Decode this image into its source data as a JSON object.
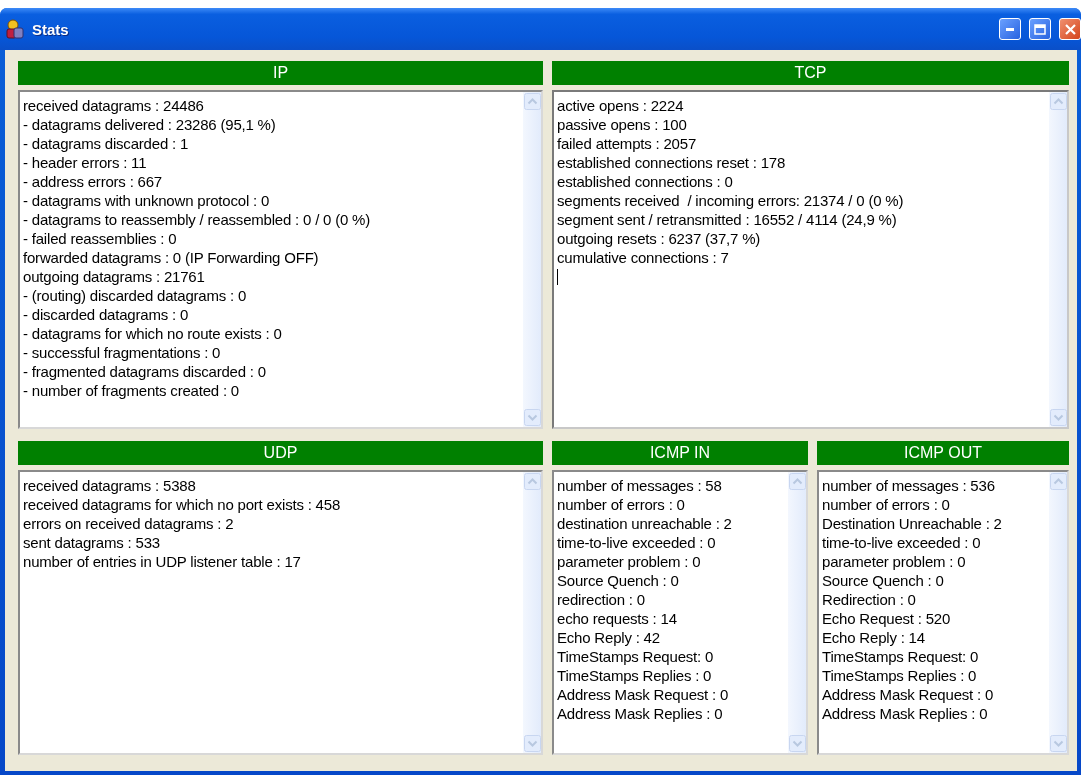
{
  "window": {
    "title": "Stats"
  },
  "rows": [
    {
      "panels": [
        {
          "title": "IP",
          "focused": false,
          "lines": [
            "received datagrams : 24486",
            "- datagrams delivered : 23286 (95,1 %)",
            "- datagrams discarded : 1",
            "- header errors : 11",
            "- address errors : 667",
            "- datagrams with unknown protocol : 0",
            "- datagrams to reassembly / reassembled : 0 / 0 (0 %)",
            "- failed reassemblies : 0",
            "forwarded datagrams : 0 (IP Forwarding OFF)",
            "outgoing datagrams : 21761",
            "- (routing) discarded datagrams : 0",
            "- discarded datagrams : 0",
            "- datagrams for which no route exists : 0",
            "- successful fragmentations : 0",
            "- fragmented datagrams discarded : 0",
            "- number of fragments created : 0"
          ]
        },
        {
          "title": "TCP",
          "focused": true,
          "lines": [
            "active opens : 2224",
            "passive opens : 100",
            "failed attempts : 2057",
            "established connections reset : 178",
            "established connections : 0",
            "segments received  / incoming errors: 21374 / 0 (0 %)",
            "segment sent / retransmitted : 16552 / 4114 (24,9 %)",
            "outgoing resets : 6237 (37,7 %)",
            "cumulative connections : 7"
          ]
        }
      ]
    },
    {
      "panels": [
        {
          "title": "UDP",
          "focused": false,
          "lines": [
            "received datagrams : 5388",
            "received datagrams for which no port exists : 458",
            "errors on received datagrams : 2",
            "sent datagrams : 533",
            "number of entries in UDP listener table : 17"
          ]
        },
        {
          "title": "ICMP IN",
          "focused": false,
          "lines": [
            "number of messages : 58",
            "number of errors : 0",
            "destination unreachable : 2",
            "time-to-live exceeded : 0",
            "parameter problem : 0",
            "Source Quench : 0",
            "redirection : 0",
            "echo requests : 14",
            "Echo Reply : 42",
            "TimeStamps Request: 0",
            "TimeStamps Replies : 0",
            "Address Mask Request : 0",
            "Address Mask Replies : 0"
          ]
        },
        {
          "title": "ICMP OUT",
          "focused": false,
          "lines": [
            "number of messages : 536",
            "number of errors : 0",
            "Destination Unreachable : 2",
            "time-to-live exceeded : 0",
            "parameter problem : 0",
            "Source Quench : 0",
            "Redirection : 0",
            "Echo Request : 520",
            "Echo Reply : 14",
            "TimeStamps Request: 0",
            "TimeStamps Replies : 0",
            "Address Mask Request : 0",
            "Address Mask Replies : 0"
          ]
        }
      ]
    }
  ]
}
